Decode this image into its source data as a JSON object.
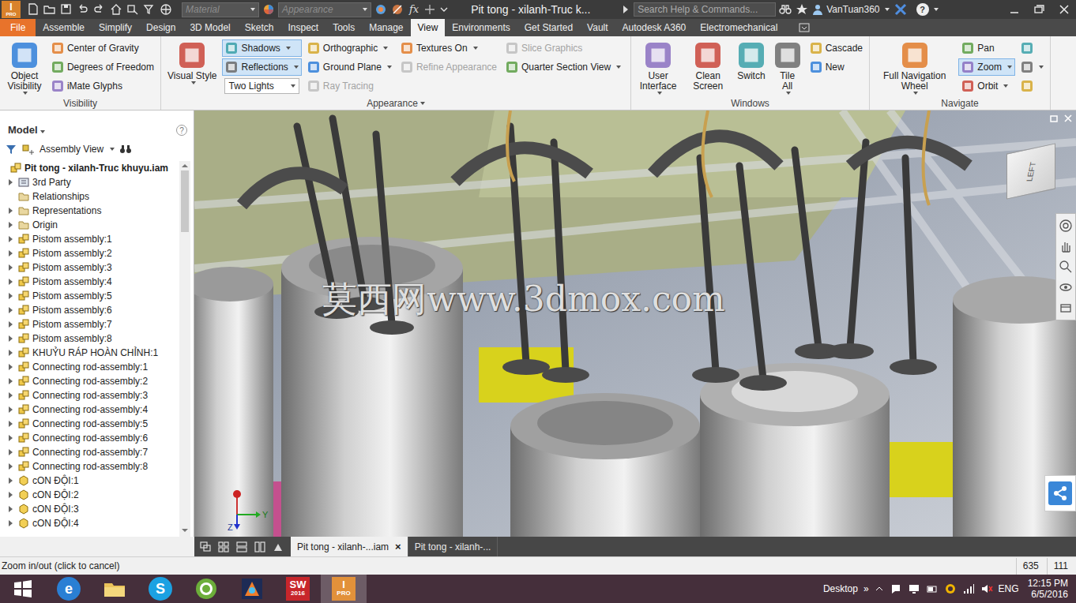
{
  "window": {
    "app_glyph": "I",
    "app_sub": "PRO",
    "material": "Material",
    "appearance": "Appearance",
    "fx": "fx",
    "title": "Pit tong - xilanh-Truc k...",
    "search_placeholder": "Search Help & Commands...",
    "user": "VanTuan360",
    "help": "?"
  },
  "ribbon_tabs": [
    {
      "label": "File",
      "selected": false,
      "kind": "file"
    },
    {
      "label": "Assemble",
      "selected": false,
      "kind": "tab"
    },
    {
      "label": "Simplify",
      "selected": false,
      "kind": "tab"
    },
    {
      "label": "Design",
      "selected": false,
      "kind": "tab"
    },
    {
      "label": "3D Model",
      "selected": false,
      "kind": "tab"
    },
    {
      "label": "Sketch",
      "selected": false,
      "kind": "tab"
    },
    {
      "label": "Inspect",
      "selected": false,
      "kind": "tab"
    },
    {
      "label": "Tools",
      "selected": false,
      "kind": "tab"
    },
    {
      "label": "Manage",
      "selected": false,
      "kind": "tab"
    },
    {
      "label": "View",
      "selected": true,
      "kind": "tab"
    },
    {
      "label": "Environments",
      "selected": false,
      "kind": "tab"
    },
    {
      "label": "Get Started",
      "selected": false,
      "kind": "tab"
    },
    {
      "label": "Vault",
      "selected": false,
      "kind": "tab"
    },
    {
      "label": "Autodesk A360",
      "selected": false,
      "kind": "tab"
    },
    {
      "label": "Electromechanical",
      "selected": false,
      "kind": "tab"
    }
  ],
  "ribbon_groups": [
    {
      "title": "Visibility",
      "has_menu": false,
      "columns": [
        {
          "kind": "large",
          "tools": [
            {
              "label": "Object Visibility",
              "kind": "large",
              "selected": false,
              "disabled": false,
              "dropdown": true
            }
          ]
        },
        {
          "kind": "small",
          "tools": [
            {
              "label": "Center of Gravity",
              "kind": "small",
              "selected": false,
              "disabled": false,
              "dropdown": false
            },
            {
              "label": "Degrees of Freedom",
              "kind": "small",
              "selected": false,
              "disabled": false,
              "dropdown": false
            },
            {
              "label": "iMate Glyphs",
              "kind": "small",
              "selected": false,
              "disabled": false,
              "dropdown": false
            }
          ]
        }
      ]
    },
    {
      "title": "Appearance",
      "has_menu": true,
      "columns": [
        {
          "kind": "large",
          "tools": [
            {
              "label": "Visual Style",
              "kind": "large",
              "selected": false,
              "disabled": false,
              "dropdown": true
            }
          ]
        },
        {
          "kind": "small",
          "tools": [
            {
              "label": "Shadows",
              "kind": "small",
              "selected": true,
              "disabled": false,
              "dropdown": true
            },
            {
              "label": "Reflections",
              "kind": "small",
              "selected": true,
              "disabled": false,
              "dropdown": true
            },
            {
              "label": "Two Lights",
              "kind": "combo",
              "selected": false,
              "disabled": false,
              "dropdown": true
            }
          ]
        },
        {
          "kind": "small",
          "tools": [
            {
              "label": "Orthographic",
              "kind": "small",
              "selected": false,
              "disabled": false,
              "dropdown": true
            },
            {
              "label": "Ground Plane",
              "kind": "small",
              "selected": false,
              "disabled": false,
              "dropdown": true
            },
            {
              "label": "Ray Tracing",
              "kind": "small",
              "selected": false,
              "disabled": true,
              "dropdown": false
            }
          ]
        },
        {
          "kind": "small",
          "tools": [
            {
              "label": "Textures On",
              "kind": "small",
              "selected": false,
              "disabled": false,
              "dropdown": true
            },
            {
              "label": "Refine Appearance",
              "kind": "small",
              "selected": false,
              "disabled": true,
              "dropdown": false
            }
          ]
        },
        {
          "kind": "small",
          "tools": [
            {
              "label": "Slice Graphics",
              "kind": "small",
              "selected": false,
              "disabled": true,
              "dropdown": false
            },
            {
              "label": "Quarter Section View",
              "kind": "small",
              "selected": false,
              "disabled": false,
              "dropdown": true
            }
          ]
        }
      ]
    },
    {
      "title": "Windows",
      "has_menu": false,
      "columns": [
        {
          "kind": "large",
          "tools": [
            {
              "label": "User Interface",
              "kind": "large",
              "selected": false,
              "disabled": false,
              "dropdown": true
            },
            {
              "label": "Clean Screen",
              "kind": "large",
              "selected": false,
              "disabled": false,
              "dropdown": false
            },
            {
              "label": "Switch",
              "kind": "large",
              "selected": false,
              "disabled": false,
              "dropdown": false
            },
            {
              "label": "Tile All",
              "kind": "large",
              "selected": false,
              "disabled": false,
              "dropdown": true
            }
          ]
        },
        {
          "kind": "small",
          "tools": [
            {
              "label": "Cascade",
              "kind": "small",
              "selected": false,
              "disabled": false,
              "dropdown": false
            },
            {
              "label": "New",
              "kind": "small",
              "selected": false,
              "disabled": false,
              "dropdown": false
            }
          ]
        }
      ]
    },
    {
      "title": "Navigate",
      "has_menu": false,
      "columns": [
        {
          "kind": "large",
          "tools": [
            {
              "label": "Full Navigation Wheel",
              "kind": "large",
              "selected": false,
              "disabled": false,
              "dropdown": true
            }
          ]
        },
        {
          "kind": "small",
          "tools": [
            {
              "label": "Pan",
              "kind": "small",
              "selected": false,
              "disabled": false,
              "dropdown": false
            },
            {
              "label": "Zoom",
              "kind": "small",
              "selected": true,
              "disabled": false,
              "dropdown": true
            },
            {
              "label": "Orbit",
              "kind": "small",
              "selected": false,
              "disabled": false,
              "dropdown": true
            }
          ]
        },
        {
          "kind": "small",
          "tools": [
            {
              "kind": "icon",
              "selected": false,
              "disabled": false,
              "dropdown": false
            },
            {
              "kind": "icon",
              "selected": false,
              "disabled": false,
              "dropdown": true
            },
            {
              "kind": "icon",
              "selected": false,
              "disabled": false,
              "dropdown": false
            }
          ]
        }
      ]
    }
  ],
  "browser": {
    "title": "Model",
    "help": "?",
    "view": "Assembly View",
    "items": [
      {
        "label": "Pit tong - xilanh-Truc khuyu.iam",
        "kind": "root",
        "expandable": false,
        "expanded": false
      },
      {
        "label": "3rd Party",
        "kind": "thirdparty",
        "expandable": true,
        "expanded": false
      },
      {
        "label": "Relationships",
        "kind": "folder",
        "expandable": false,
        "expanded": false
      },
      {
        "label": "Representations",
        "kind": "folder",
        "expandable": true,
        "expanded": false
      },
      {
        "label": "Origin",
        "kind": "folder",
        "expandable": true,
        "expanded": false
      },
      {
        "label": "Pistom assembly:1",
        "kind": "assembly",
        "expandable": true,
        "expanded": false
      },
      {
        "label": "Pistom assembly:2",
        "kind": "assembly",
        "expandable": true,
        "expanded": false
      },
      {
        "label": "Pistom assembly:3",
        "kind": "assembly",
        "expandable": true,
        "expanded": false
      },
      {
        "label": "Pistom assembly:4",
        "kind": "assembly",
        "expandable": true,
        "expanded": false
      },
      {
        "label": "Pistom assembly:5",
        "kind": "assembly",
        "expandable": true,
        "expanded": false
      },
      {
        "label": "Pistom assembly:6",
        "kind": "assembly",
        "expandable": true,
        "expanded": false
      },
      {
        "label": "Pistom assembly:7",
        "kind": "assembly",
        "expandable": true,
        "expanded": false
      },
      {
        "label": "Pistom assembly:8",
        "kind": "assembly",
        "expandable": true,
        "expanded": false
      },
      {
        "label": "KHUỶU RÁP HOÀN CHỈNH:1",
        "kind": "assembly",
        "expandable": true,
        "expanded": false
      },
      {
        "label": "Connecting rod-assembly:1",
        "kind": "assembly",
        "expandable": true,
        "expanded": false
      },
      {
        "label": "Connecting rod-assembly:2",
        "kind": "assembly",
        "expandable": true,
        "expanded": false
      },
      {
        "label": "Connecting rod-assembly:3",
        "kind": "assembly",
        "expandable": true,
        "expanded": false
      },
      {
        "label": "Connecting rod-assembly:4",
        "kind": "assembly",
        "expandable": true,
        "expanded": false
      },
      {
        "label": "Connecting rod-assembly:5",
        "kind": "assembly",
        "expandable": true,
        "expanded": false
      },
      {
        "label": "Connecting rod-assembly:6",
        "kind": "assembly",
        "expandable": true,
        "expanded": false
      },
      {
        "label": "Connecting rod-assembly:7",
        "kind": "assembly",
        "expandable": true,
        "expanded": false
      },
      {
        "label": "Connecting rod-assembly:8",
        "kind": "assembly",
        "expandable": true,
        "expanded": false
      },
      {
        "label": "cON ĐỘI:1",
        "kind": "part",
        "expandable": true,
        "expanded": false
      },
      {
        "label": "cON ĐỘI:2",
        "kind": "part",
        "expandable": true,
        "expanded": false
      },
      {
        "label": "cON ĐỘI:3",
        "kind": "part",
        "expandable": true,
        "expanded": false
      },
      {
        "label": "cON ĐỘI:4",
        "kind": "part",
        "expandable": true,
        "expanded": false
      }
    ]
  },
  "viewport": {
    "watermark": "莫西网www.3dmox.com",
    "viewcube_label": "LEFT",
    "axes": [
      "Y",
      "Z"
    ]
  },
  "doc_tabs": [
    {
      "label": "Pit tong - xilanh-...iam",
      "selected": true,
      "close": "×"
    },
    {
      "label": "Pit tong - xilanh-...",
      "selected": false
    }
  ],
  "status_bar": {
    "message": "Zoom in/out (click to cancel)",
    "x": "635",
    "y": "111"
  },
  "taskbar": {
    "apps": [
      {
        "kind": "start",
        "active": false
      },
      {
        "kind": "ie",
        "glyph": "e",
        "active": false
      },
      {
        "kind": "explorer",
        "active": false
      },
      {
        "kind": "skype",
        "glyph": "S",
        "active": false
      },
      {
        "kind": "green",
        "active": false
      },
      {
        "kind": "render",
        "active": false
      },
      {
        "kind": "solidworks",
        "glyph": "SW",
        "sub": "2016",
        "active": false
      },
      {
        "kind": "inventor",
        "glyph": "I",
        "sub": "PRO",
        "active": true
      }
    ],
    "desktop": "Desktop",
    "more": "»",
    "lang": "ENG",
    "time": "12:15 PM",
    "date": "6/5/2016"
  }
}
